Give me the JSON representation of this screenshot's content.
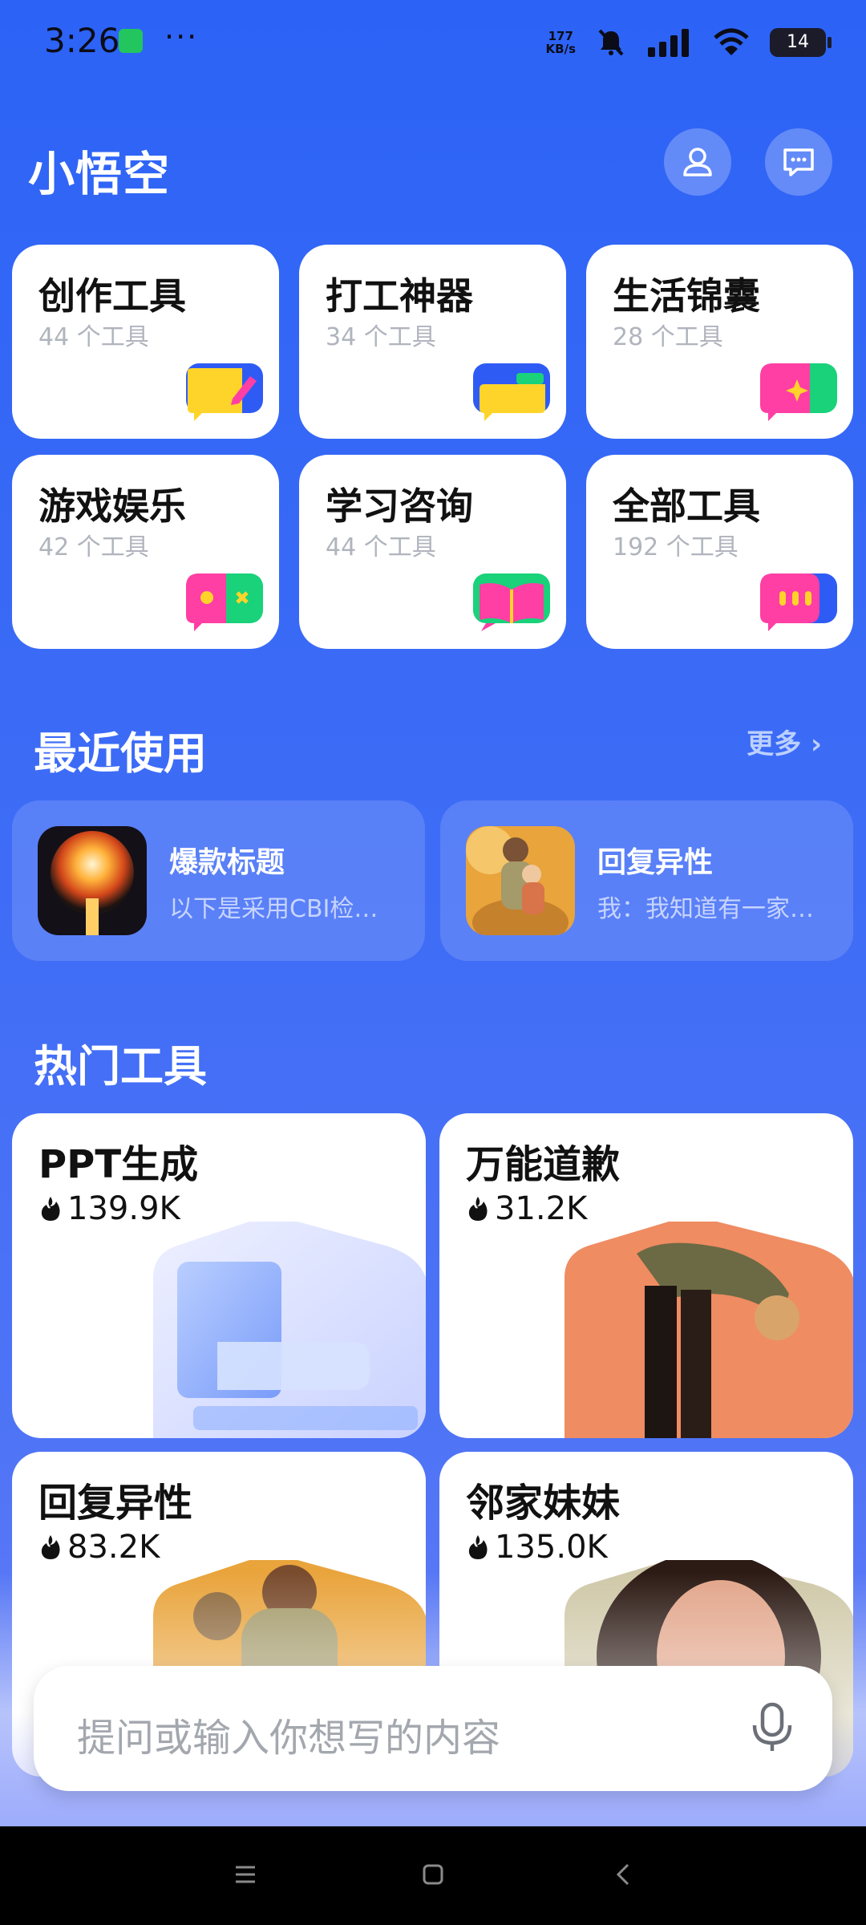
{
  "status": {
    "time": "3:26",
    "network_speed_value": "177",
    "network_speed_unit": "KB/s",
    "battery": "14",
    "icons": [
      "shield-check-icon",
      "more-dots-icon",
      "mute-bell-icon",
      "signal-icon",
      "wifi-icon",
      "battery-charging-icon"
    ]
  },
  "app": {
    "title": "小悟空",
    "profile_icon": "user-icon",
    "message_icon": "chat-icon"
  },
  "categories": [
    {
      "name": "创作工具",
      "count": "44 个工具",
      "icon": "pencil-chat-icon"
    },
    {
      "name": "打工神器",
      "count": "34 个工具",
      "icon": "folder-chat-icon"
    },
    {
      "name": "生活锦囊",
      "count": "28 个工具",
      "icon": "sparkle-chat-icon"
    },
    {
      "name": "游戏娱乐",
      "count": "42 个工具",
      "icon": "game-chat-icon"
    },
    {
      "name": "学习咨询",
      "count": "44 个工具",
      "icon": "book-chat-icon"
    },
    {
      "name": "全部工具",
      "count": "192 个工具",
      "icon": "dots-chat-icon"
    }
  ],
  "recent": {
    "title": "最近使用",
    "more": "更多 ›",
    "items": [
      {
        "title": "爆款标题",
        "subtitle": "以下是采用CBI检…",
        "thumb": "explosion-image"
      },
      {
        "title": "回复异性",
        "subtitle": "我：我知道有一家…",
        "thumb": "couple-image"
      }
    ]
  },
  "hot": {
    "title": "热门工具",
    "items": [
      {
        "name": "PPT生成",
        "count": "139.9K",
        "art": "glass-folder-image"
      },
      {
        "name": "万能道歉",
        "count": "31.2K",
        "art": "bowing-man-image"
      },
      {
        "name": "回复异性",
        "count": "83.2K",
        "art": "couple-image"
      },
      {
        "name": "邻家妹妹",
        "count": "135.0K",
        "art": "smiling-girl-image"
      }
    ]
  },
  "input": {
    "placeholder": "提问或输入你想写的内容",
    "mic_icon": "microphone-icon"
  },
  "navbar": {
    "icons": [
      "menu-icon",
      "home-square-icon",
      "back-chevron-icon"
    ]
  },
  "colors": {
    "background_top": "#2c63f6",
    "background_bottom": "#6a7ff4",
    "card": "#ffffff",
    "muted_text": "#b0b4bd"
  }
}
